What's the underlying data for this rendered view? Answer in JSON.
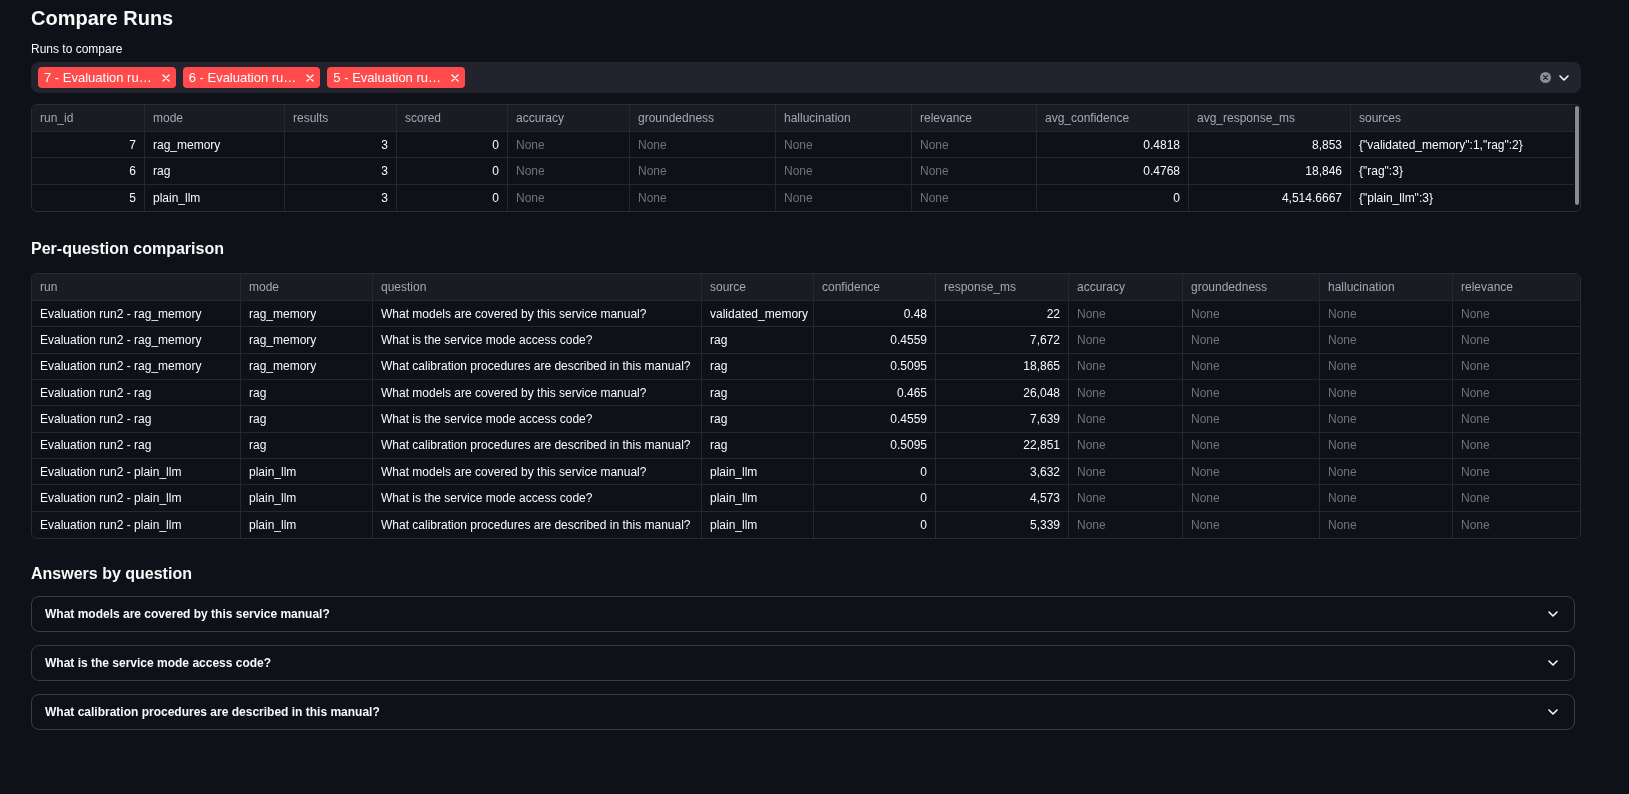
{
  "page": {
    "title": "Compare Runs"
  },
  "run_selector": {
    "label": "Runs to compare",
    "chips": [
      "7 - Evaluation ru…",
      "6 - Evaluation ru…",
      "5 - Evaluation ru…"
    ]
  },
  "summary_table": {
    "columns": [
      {
        "label": "run_id",
        "kind": "number"
      },
      {
        "label": "mode",
        "kind": "text"
      },
      {
        "label": "results",
        "kind": "number"
      },
      {
        "label": "scored",
        "kind": "number"
      },
      {
        "label": "accuracy",
        "kind": "score"
      },
      {
        "label": "groundedness",
        "kind": "score"
      },
      {
        "label": "hallucination",
        "kind": "score"
      },
      {
        "label": "relevance",
        "kind": "score"
      },
      {
        "label": "avg_confidence",
        "kind": "number"
      },
      {
        "label": "avg_response_ms",
        "kind": "number"
      },
      {
        "label": "sources",
        "kind": "text"
      }
    ],
    "rows": [
      [
        "7",
        "rag_memory",
        "3",
        "0",
        "None",
        "None",
        "None",
        "None",
        "0.4818",
        "8,853",
        "{\"validated_memory\":1,\"rag\":2}"
      ],
      [
        "6",
        "rag",
        "3",
        "0",
        "None",
        "None",
        "None",
        "None",
        "0.4768",
        "18,846",
        "{\"rag\":3}"
      ],
      [
        "5",
        "plain_llm",
        "3",
        "0",
        "None",
        "None",
        "None",
        "None",
        "0",
        "4,514.6667",
        "{\"plain_llm\":3}"
      ]
    ]
  },
  "per_question": {
    "heading": "Per-question comparison",
    "columns": [
      {
        "label": "run",
        "kind": "text"
      },
      {
        "label": "mode",
        "kind": "text"
      },
      {
        "label": "question",
        "kind": "text"
      },
      {
        "label": "source",
        "kind": "text"
      },
      {
        "label": "confidence",
        "kind": "number"
      },
      {
        "label": "response_ms",
        "kind": "number"
      },
      {
        "label": "accuracy",
        "kind": "score"
      },
      {
        "label": "groundedness",
        "kind": "score"
      },
      {
        "label": "hallucination",
        "kind": "score"
      },
      {
        "label": "relevance",
        "kind": "score"
      }
    ],
    "rows": [
      [
        "Evaluation run2 - rag_memory",
        "rag_memory",
        "What models are covered by this service manual?",
        "validated_memory",
        "0.48",
        "22",
        "None",
        "None",
        "None",
        "None"
      ],
      [
        "Evaluation run2 - rag_memory",
        "rag_memory",
        "What is the service mode access code?",
        "rag",
        "0.4559",
        "7,672",
        "None",
        "None",
        "None",
        "None"
      ],
      [
        "Evaluation run2 - rag_memory",
        "rag_memory",
        "What calibration procedures are described in this manual?",
        "rag",
        "0.5095",
        "18,865",
        "None",
        "None",
        "None",
        "None"
      ],
      [
        "Evaluation run2 - rag",
        "rag",
        "What models are covered by this service manual?",
        "rag",
        "0.465",
        "26,048",
        "None",
        "None",
        "None",
        "None"
      ],
      [
        "Evaluation run2 - rag",
        "rag",
        "What is the service mode access code?",
        "rag",
        "0.4559",
        "7,639",
        "None",
        "None",
        "None",
        "None"
      ],
      [
        "Evaluation run2 - rag",
        "rag",
        "What calibration procedures are described in this manual?",
        "rag",
        "0.5095",
        "22,851",
        "None",
        "None",
        "None",
        "None"
      ],
      [
        "Evaluation run2 - plain_llm",
        "plain_llm",
        "What models are covered by this service manual?",
        "plain_llm",
        "0",
        "3,632",
        "None",
        "None",
        "None",
        "None"
      ],
      [
        "Evaluation run2 - plain_llm",
        "plain_llm",
        "What is the service mode access code?",
        "plain_llm",
        "0",
        "4,573",
        "None",
        "None",
        "None",
        "None"
      ],
      [
        "Evaluation run2 - plain_llm",
        "plain_llm",
        "What calibration procedures are described in this manual?",
        "plain_llm",
        "0",
        "5,339",
        "None",
        "None",
        "None",
        "None"
      ]
    ]
  },
  "answers": {
    "heading": "Answers by question",
    "items": [
      {
        "question": "What models are covered by this service manual?",
        "expanded": false
      },
      {
        "question": "What is the service mode access code?",
        "expanded": false
      },
      {
        "question": "What calibration procedures are described in this manual?",
        "expanded": false
      }
    ]
  }
}
